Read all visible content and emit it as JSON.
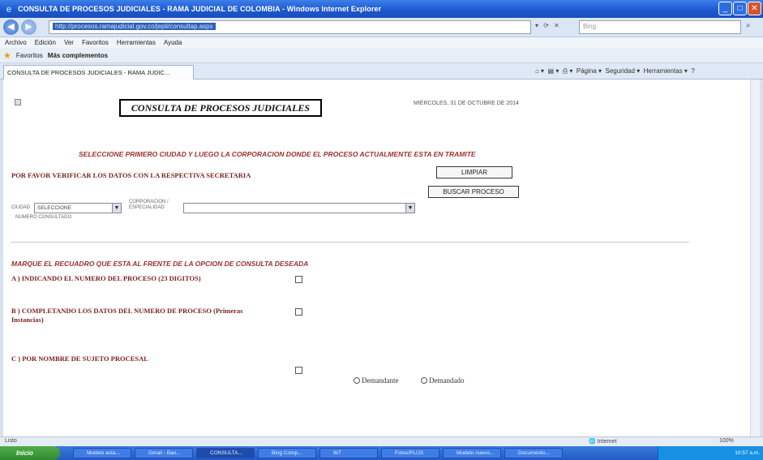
{
  "window": {
    "title": "CONSULTA DE PROCESOS JUDICIALES - RAMA JUDICIAL DE COLOMBIA - Windows Internet Explorer"
  },
  "addressbar": {
    "url": "http://procesos.ramajudicial.gov.co/jepli/consultap.aspx"
  },
  "menu": {
    "items": [
      "Archivo",
      "Edición",
      "Ver",
      "Favoritos",
      "Herramientas",
      "Ayuda"
    ]
  },
  "favorites": {
    "label": "Favoritos",
    "more": "Más complementos"
  },
  "tab": {
    "label": "CONSULTA DE PROCESOS JUDICIALES - RAMA JUDIC..."
  },
  "command_bar": {
    "page": "Página",
    "security": "Seguridad",
    "tools": "Herramientas"
  },
  "page": {
    "title": "CONSULTA DE PROCESOS JUDICIALES",
    "date": "MIÉRCOLES, 31 DE OCTUBRE DE 2014",
    "select_message": "SELECCIONE PRIMERO CIUDAD Y LUEGO LA CORPORACION DONDE EL PROCESO ACTUALMENTE ESTA EN TRAMITE",
    "verify_message": "POR FAVOR VERIFICAR LOS DATOS CON LA RESPECTIVA SECRETARIA",
    "limpiar_button": "LIMPIAR",
    "buscar_button": "BUSCAR PROCESO",
    "ciudad_label": "CIUDAD",
    "ciudad_value": "SELECCIONE",
    "corporacion_label": "CORPORACION / ESPECIALIDAD",
    "corporacion_value": "",
    "numero_consultado_label": "NUMERO CONSULTADO",
    "marque_message": "MARQUE EL RECUADRO QUE ESTA AL FRENTE DE LA OPCION DE CONSULTA DESEADA",
    "option_a": "A ) INDICANDO EL NUMERO DEL PROCESO (23 DIGITOS)",
    "option_b": "B ) COMPLETANDO LOS DATOS DEL NUMERO DE PROCESO (Primeras Instancias)",
    "option_c": "C ) POR NOMBRE DE SUJETO PROCESAL",
    "radio_demandante": "Demandante",
    "radio_demandado": "Demandado"
  },
  "statusbar": {
    "left": "Listo",
    "zone": "Internet",
    "zoom": "100%"
  },
  "taskbar": {
    "start": "Inicio",
    "tasks": [
      "Modelo acta...",
      "Gmail - Ban...",
      "CONSULTA...",
      "Bing Comp...",
      "W7",
      "Fotos/PLUS",
      "Modelo nuevo...",
      "Documento..."
    ],
    "clock": "10:57 a.m."
  }
}
